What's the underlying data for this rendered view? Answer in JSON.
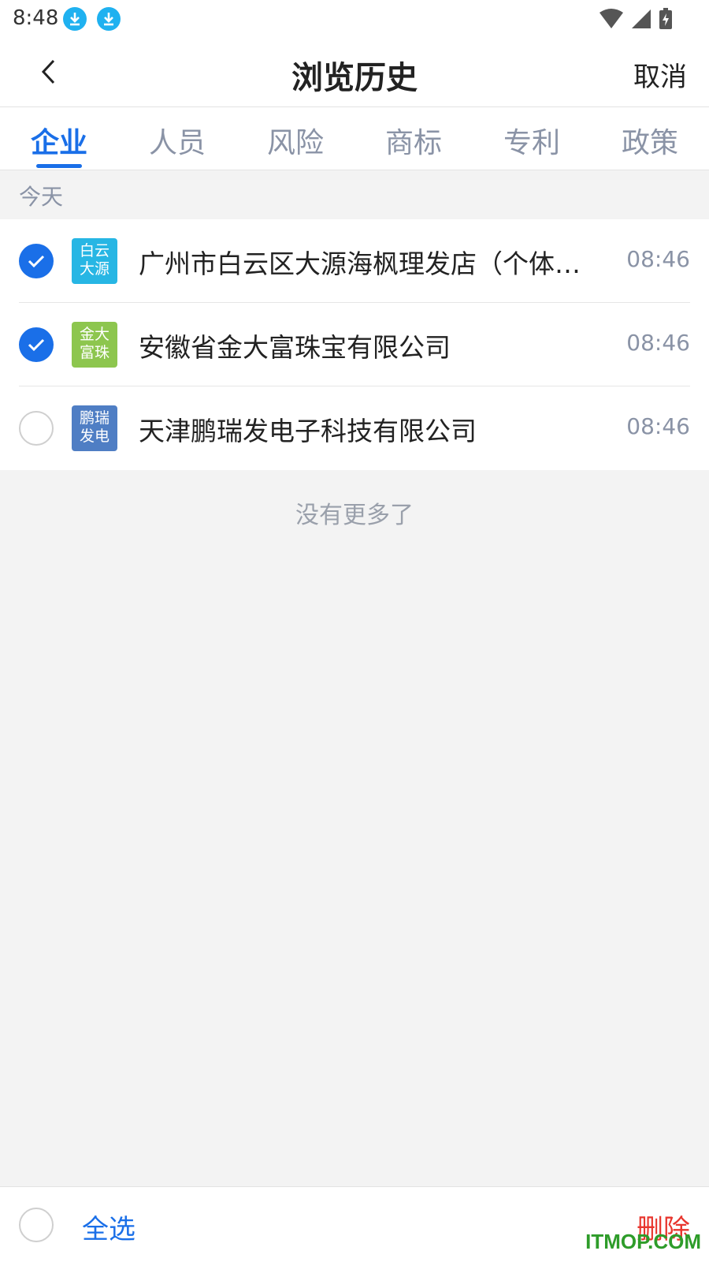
{
  "status_bar": {
    "time": "8:48"
  },
  "header": {
    "title": "浏览历史",
    "cancel_label": "取消"
  },
  "tabs": [
    {
      "label": "企业",
      "active": true
    },
    {
      "label": "人员"
    },
    {
      "label": "风险"
    },
    {
      "label": "商标"
    },
    {
      "label": "专利"
    },
    {
      "label": "政策"
    }
  ],
  "section": {
    "label": "今天"
  },
  "items": [
    {
      "logo_line1": "白云",
      "logo_line2": "大源",
      "logo_color": "#27b6e4",
      "name": "广州市白云区大源海枫理发店（个体工商户）",
      "time": "08:46",
      "checked": true
    },
    {
      "logo_line1": "金大",
      "logo_line2": "富珠",
      "logo_color": "#8dc64e",
      "name": "安徽省金大富珠宝有限公司",
      "time": "08:46",
      "checked": true
    },
    {
      "logo_line1": "鹏瑞",
      "logo_line2": "发电",
      "logo_color": "#4f7ec4",
      "name": "天津鹏瑞发电子科技有限公司",
      "time": "08:46",
      "checked": false
    }
  ],
  "no_more_text": "没有更多了",
  "footer": {
    "select_all_label": "全选",
    "delete_label": "删除",
    "watermark": "ITMOP.COM"
  },
  "colors": {
    "accent": "#1a6fe8",
    "danger": "#e8362e"
  }
}
